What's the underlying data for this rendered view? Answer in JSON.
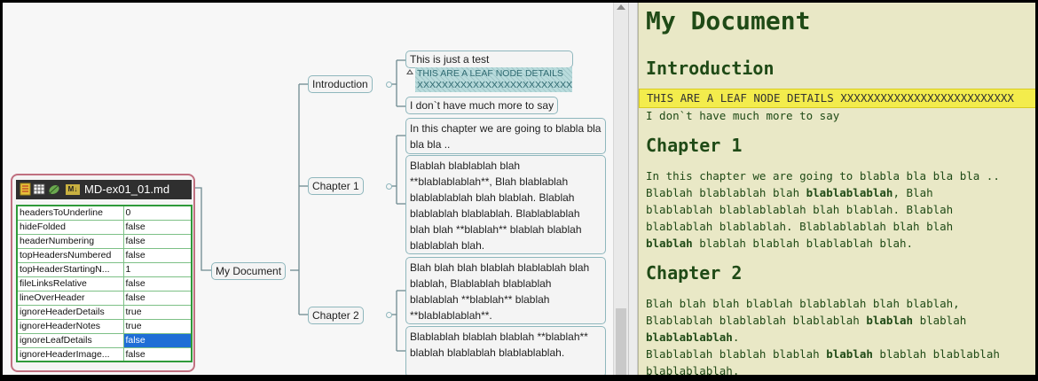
{
  "mindmap": {
    "root": "My Document",
    "branches": [
      {
        "label": "Introduction",
        "children": [
          "This is just a test",
          "I don`t have much more to say"
        ]
      },
      {
        "label": "Chapter 1",
        "children": [
          "In this chapter we are going to blabla bla bla bla ..",
          "Blablah  blablablah blah **blablablablah**, Blah  blablablah blablablablah blah blablah. Blablah  blablablah blablablah. Blablablablah  blah blah **blablah** blablah blablah blablablah blah."
        ]
      },
      {
        "label": "Chapter 2",
        "children": [
          "Blah  blah blah blablah blablablah blah blablah, Blablablah  blablablah blablablah **blablah** blablah **blablablablah**.",
          "Blablablah  blablah blablah **blablah** blablah blablablah blablablablah."
        ]
      }
    ],
    "leaf_detail": "THIS ARE A LEAF NODE DETAILS XXXXXXXXXXXXXXXXXXXXXXXXXX"
  },
  "attr_node": {
    "title": "MD-ex01_01.md",
    "md_badge": "M↓",
    "rows": [
      {
        "key": "headersToUnderline",
        "value": "0"
      },
      {
        "key": "hideFolded",
        "value": "false"
      },
      {
        "key": "headerNumbering",
        "value": "false"
      },
      {
        "key": "topHeadersNumbered",
        "value": "false"
      },
      {
        "key": "topHeaderStartingN...",
        "value": "1"
      },
      {
        "key": "fileLinksRelative",
        "value": "false"
      },
      {
        "key": "lineOverHeader",
        "value": "false"
      },
      {
        "key": "ignoreHeaderDetails",
        "value": "true"
      },
      {
        "key": "ignoreHeaderNotes",
        "value": "true"
      },
      {
        "key": "ignoreLeafDetails",
        "value": "false"
      },
      {
        "key": "ignoreHeaderImage...",
        "value": "false"
      }
    ],
    "selected_row": 9
  },
  "preview": {
    "h1": "My Document",
    "h2_intro": "Introduction",
    "intro_highlight": "THIS ARE A LEAF NODE DETAILS XXXXXXXXXXXXXXXXXXXXXXXXXX",
    "intro_text": "I don`t have much more to say",
    "h2_ch1": "Chapter 1",
    "ch1_p1": "In this chapter we are going to blabla bla bla bla ..",
    "ch1_p2_a": "Blablah blablablah blah ",
    "ch1_p2_b1": "blablablablah",
    "ch1_p2_c": ", Blah\nblablablah blablablablah blah blablah. Blablah\nblablablah blablablah. Blablablablah blah blah\n",
    "ch1_p2_b2": "blablah",
    "ch1_p2_d": " blablah blablah blablablah blah.",
    "h2_ch2": "Chapter 2",
    "ch2_p1_a": "Blah blah blah blablah blablablah blah blablah,\nBlablablah blablablah blablablah ",
    "ch2_p1_b1": "blablah",
    "ch2_p1_c": " blablah\n",
    "ch2_p1_b2": "blablablablah",
    "ch2_p1_d": ".",
    "ch2_p2_a": "Blablablah blablah blablah ",
    "ch2_p2_b": "blablah",
    "ch2_p2_c": " blablah blablablah\nblablablablah."
  },
  "colors": {
    "preview_bg": "#e9e8c6",
    "preview_text": "#1f4a16",
    "highlight": "#f3ec4c",
    "selection": "#1e6ed6",
    "node_border": "#8fb7bd"
  }
}
